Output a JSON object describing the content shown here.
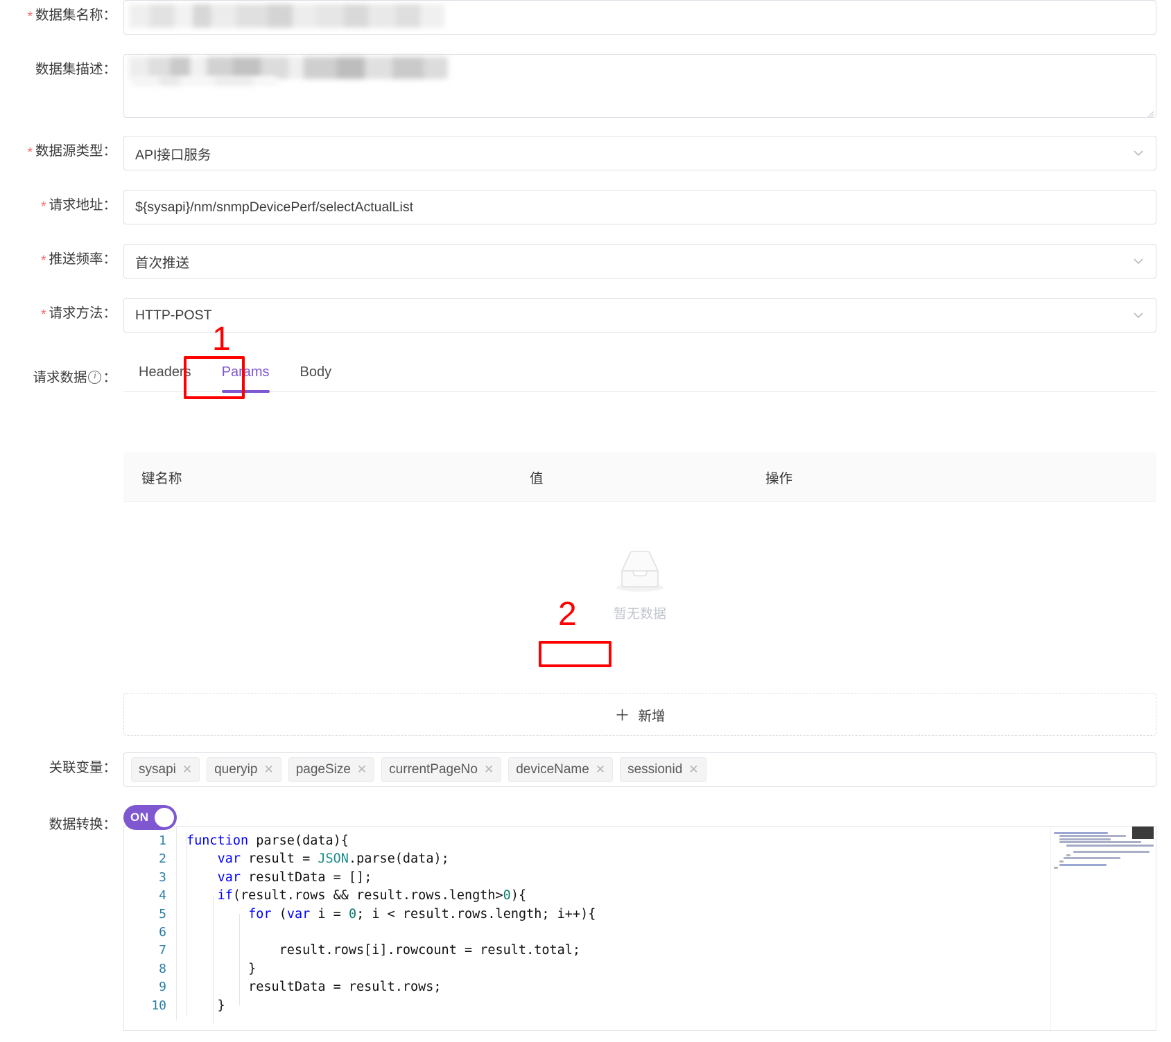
{
  "form": {
    "dataset_name": {
      "label": "数据集名称：",
      "required": true,
      "value": "",
      "redacted": true
    },
    "dataset_desc": {
      "label": "数据集描述：",
      "required": false,
      "value": "",
      "redacted": true
    },
    "source_type": {
      "label": "数据源类型：",
      "required": true,
      "value": "API接口服务",
      "icon": "chevron-down-icon"
    },
    "request_url": {
      "label": "请求地址：",
      "required": true,
      "value": "${sysapi}/nm/snmpDevicePerf/selectActualList"
    },
    "push_freq": {
      "label": "推送频率：",
      "required": true,
      "value": "首次推送",
      "icon": "chevron-down-icon"
    },
    "request_method": {
      "label": "请求方法：",
      "required": true,
      "value": "HTTP-POST",
      "icon": "chevron-down-icon"
    },
    "request_data": {
      "label": "请求数据",
      "label_suffix": "：",
      "info_icon": "info-circle-icon"
    },
    "related_vars": {
      "label": "关联变量："
    },
    "data_transform": {
      "label": "数据转换："
    }
  },
  "tabs": [
    {
      "label": "Headers",
      "active": false
    },
    {
      "label": "Params",
      "active": true
    },
    {
      "label": "Body",
      "active": false
    }
  ],
  "table": {
    "columns": [
      "键名称",
      "值",
      "操作"
    ],
    "rows": [],
    "empty_text": "暂无数据",
    "empty_icon": "empty-inbox-icon"
  },
  "add_button": {
    "label": "新增",
    "icon": "plus-icon"
  },
  "related_vars": [
    {
      "name": "sysapi"
    },
    {
      "name": "queryip"
    },
    {
      "name": "pageSize"
    },
    {
      "name": "currentPageNo"
    },
    {
      "name": "deviceName"
    },
    {
      "name": "sessionid"
    }
  ],
  "toggle": {
    "state_label": "ON",
    "on": true,
    "color": "#7e57d1"
  },
  "code": {
    "language": "javascript",
    "line_numbers": [
      "1",
      "2",
      "3",
      "4",
      "5",
      "6",
      "7",
      "8",
      "9",
      "10"
    ],
    "lines": [
      "function parse(data){",
      "    var result = JSON.parse(data);",
      "    var resultData = [];",
      "    if(result.rows && result.rows.length>0){",
      "        for (var i = 0; i < result.rows.length; i++){",
      "",
      "            result.rows[i].rowcount = result.total;",
      "        }",
      "        resultData = result.rows;",
      "    }"
    ]
  },
  "annotations": [
    {
      "number": "1",
      "target": "params-tab"
    },
    {
      "number": "2",
      "target": "add-button"
    }
  ],
  "colors": {
    "accent": "#7e57d1",
    "required_star": "#f56c6c",
    "annotation": "#ff0000",
    "border": "#dcdfe6",
    "placeholder": "#c0c4cc"
  }
}
